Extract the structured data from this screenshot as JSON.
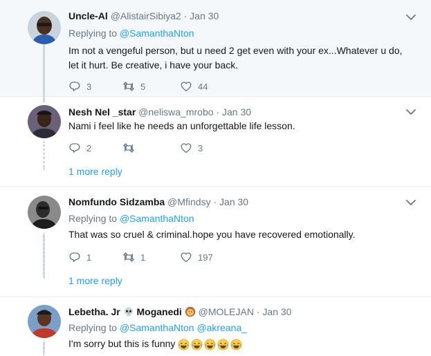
{
  "tweets": [
    {
      "name": "Uncle-Al",
      "handle": "@AlistairSibiya2",
      "sep": "·",
      "date": "Jan 30",
      "replying_label": "Replying to",
      "replying_to": "@SamanthaNton",
      "text": "Im not a vengeful person, but u need 2 get even with your ex...Whatever u do, let it hurt. Be creative, i have your back.",
      "replies": "3",
      "retweets": "5",
      "likes": "44"
    },
    {
      "name": "Nesh Nel _star",
      "handle": "@neliswa_mrobo",
      "sep": "·",
      "date": "Jan 30",
      "text": "Nami i feel like he needs an unforgettable life lesson.",
      "replies": "2",
      "retweets": "",
      "likes": "3",
      "more_replies": "1 more reply"
    },
    {
      "name": "Nomfundo Sidzamba",
      "handle": "@Mfindsy",
      "sep": "·",
      "date": "Jan 30",
      "replying_label": "Replying to",
      "replying_to": "@SamanthaNton",
      "text": "That was so cruel & criminal.hope you have recovered emotionally.",
      "replies": "1",
      "retweets": "1",
      "likes": "197",
      "more_replies": "1 more reply"
    },
    {
      "name_part1": "Lebetha. Jr",
      "name_part2": "Moganedi",
      "handle": "@MOLEJAN",
      "sep": "·",
      "date": "Jan 30",
      "replying_label": "Replying to",
      "replying_to": "@SamanthaNton",
      "replying_to_2": "@akreana_",
      "text": "I'm sorry but this is funny"
    }
  ],
  "icons": {
    "reply": "reply-icon",
    "retweet": "retweet-icon",
    "like": "heart-icon",
    "caret": "chevron-down-icon",
    "skull": "skull-emoji",
    "lion": "lion-emoji",
    "laugh": "tears-of-joy-emoji"
  },
  "colors": {
    "link": "#1da1f2",
    "muted": "#657786",
    "highlight_bg": "#f5f8fa",
    "thread_line": "#ccd6dd"
  }
}
